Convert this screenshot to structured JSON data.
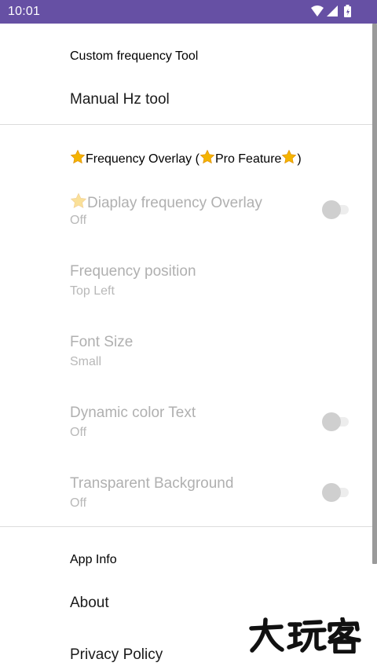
{
  "status_bar": {
    "time": "10:01"
  },
  "sections": {
    "custom_tool": {
      "header": "Custom frequency Tool",
      "manual_hz": "Manual Hz tool"
    },
    "overlay": {
      "header_part1": "Frequency Overlay (",
      "header_part2": "Pro Feature",
      "header_part3": ")",
      "display_overlay": {
        "title": "Diaplay frequency Overlay",
        "summary": "Off",
        "checked": false
      },
      "position": {
        "title": "Frequency position",
        "summary": "Top Left"
      },
      "font_size": {
        "title": "Font Size",
        "summary": "Small"
      },
      "dynamic_color": {
        "title": "Dynamic color Text",
        "summary": "Off",
        "checked": false
      },
      "transparent_bg": {
        "title": "Transparent Background",
        "summary": "Off",
        "checked": false
      }
    },
    "app_info": {
      "header": "App Info",
      "about": "About",
      "privacy": "Privacy Policy"
    }
  },
  "watermark": {
    "text": "大玩客"
  },
  "icons": {
    "star": "star-icon",
    "wifi": "wifi-icon",
    "signal": "cell-signal-icon",
    "battery": "battery-icon"
  },
  "colors": {
    "status_bar": "#6650a4",
    "star": "#f4b400",
    "disabled_text": "#b0b0b0"
  }
}
